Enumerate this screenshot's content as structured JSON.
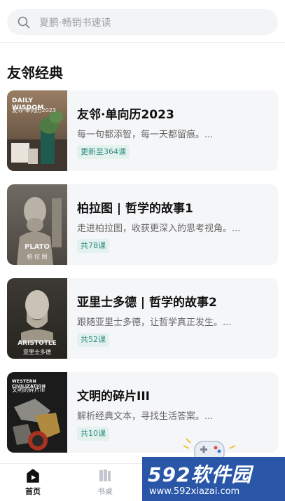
{
  "search": {
    "placeholder": "夏鹏·畅销书速读"
  },
  "section": {
    "title": "友邻经典"
  },
  "books": [
    {
      "title": "友邻·单向历2023",
      "desc": "每一句都添智，每一天都留痕。...",
      "badge": "更新至364课",
      "cover": {
        "line1": "DAILY WISDOM",
        "line2": "友邻·单向历2023"
      }
    },
    {
      "title": "柏拉图 | 哲学的故事1",
      "desc": "走进柏拉图，收获更深入的思考视角。...",
      "badge": "共78课",
      "cover": {
        "line1": "PLATO",
        "line2": "柏 拉 图"
      }
    },
    {
      "title": "亚里士多德 | 哲学的故事2",
      "desc": "跟随亚里士多德，让哲学真正发生。...",
      "badge": "共52课",
      "cover": {
        "line1": "ARISTOTLE",
        "line2": "亚里士多德"
      }
    },
    {
      "title": "文明的碎片III",
      "desc": "解析经典文本，寻找生活答案。...",
      "badge": "共10课",
      "cover": {
        "line1": "WESTERN CIVILIZATION",
        "line2": "文明的碎片III"
      }
    }
  ],
  "tabbar": {
    "tabs": [
      {
        "label": "首页",
        "icon": "home-icon",
        "active": true
      },
      {
        "label": "书桌",
        "icon": "desk-icon",
        "active": false
      }
    ]
  },
  "watermark": {
    "brand": "592软件园",
    "url": "www.592xiazai.com"
  },
  "colors": {
    "accent": "#111111",
    "badge_bg": "#e3f1ef",
    "badge_text": "#2f8f7f",
    "watermark_bg": "#2a56a8"
  }
}
